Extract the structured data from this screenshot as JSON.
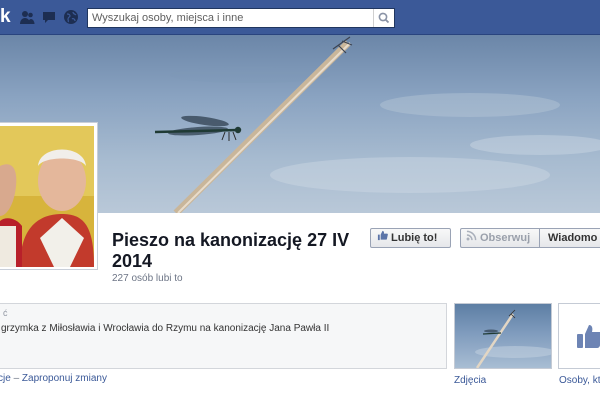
{
  "topbar": {
    "logo_fragment": "k",
    "search": {
      "placeholder": "Wyszukaj osoby, miejsca i inne",
      "value": ""
    },
    "jewels": [
      "friend-requests-icon",
      "messages-icon",
      "notifications-globe-icon"
    ],
    "search_icon": "magnifier-icon"
  },
  "page": {
    "name": "Pieszo na kanonizację 27 IV 2014",
    "likes": "227 osób lubi to"
  },
  "actions": {
    "like": "Lubię to!",
    "follow": "Obserwuj",
    "message": "Wiadomo"
  },
  "about": {
    "title": "ć",
    "text": "grzymka z Miłosławia i Wrocławia do Rzymu na kanonizację Jana Pawła II",
    "link_1": "cje",
    "separator": "–",
    "link_2": "Zaproponuj zmiany"
  },
  "tiles": {
    "photos_label": "Zdjęcia",
    "people_label": "Osoby, kt"
  },
  "colors": {
    "brand": "#3b5998",
    "link": "#3b5998",
    "muted": "#6d7586"
  }
}
